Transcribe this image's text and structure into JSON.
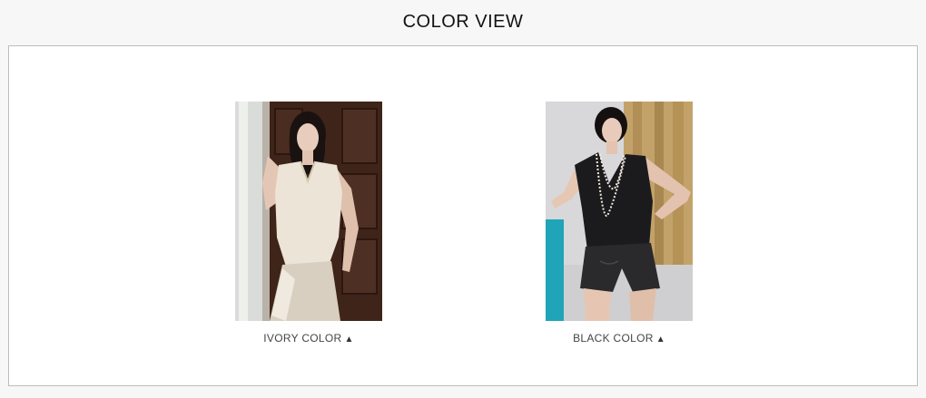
{
  "header": {
    "title": "COLOR VIEW"
  },
  "colors": [
    {
      "label": "IVORY COLOR",
      "icon": "triangle-up-icon"
    },
    {
      "label": "BLACK COLOR",
      "icon": "triangle-up-icon"
    }
  ],
  "glyphs": {
    "arrow": "▲"
  },
  "palette": {
    "background": "#f7f7f7",
    "panel": "#ffffff",
    "border": "#bdbdbd"
  }
}
